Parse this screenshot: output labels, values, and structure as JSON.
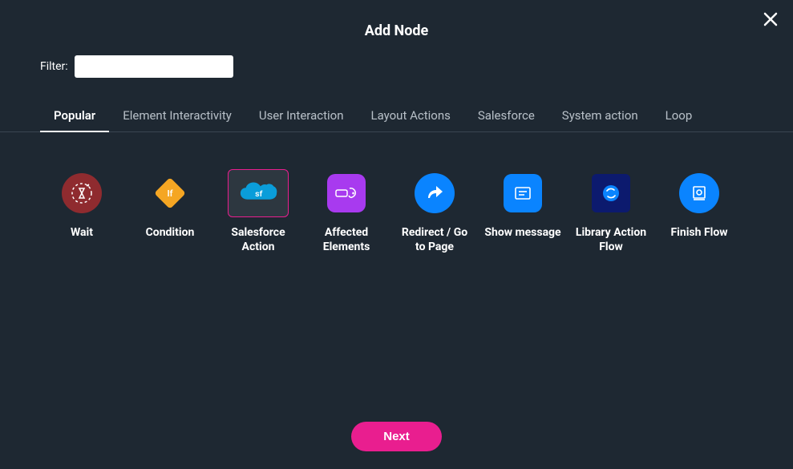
{
  "header": {
    "title": "Add Node"
  },
  "filter": {
    "label": "Filter:",
    "value": ""
  },
  "tabs": [
    {
      "label": "Popular",
      "active": true
    },
    {
      "label": "Element Interactivity",
      "active": false
    },
    {
      "label": "User Interaction",
      "active": false
    },
    {
      "label": "Layout Actions",
      "active": false
    },
    {
      "label": "Salesforce",
      "active": false
    },
    {
      "label": "System action",
      "active": false
    },
    {
      "label": "Loop",
      "active": false
    }
  ],
  "nodes": [
    {
      "label": "Wait",
      "icon": "wait",
      "selected": false
    },
    {
      "label": "Condition",
      "icon": "condition",
      "selected": false
    },
    {
      "label": "Salesforce Action",
      "icon": "salesforce",
      "selected": true
    },
    {
      "label": "Affected Elements",
      "icon": "affected",
      "selected": false
    },
    {
      "label": "Redirect / Go to Page",
      "icon": "redirect",
      "selected": false
    },
    {
      "label": "Show message",
      "icon": "show-message",
      "selected": false
    },
    {
      "label": "Library Action Flow",
      "icon": "library",
      "selected": false
    },
    {
      "label": "Finish Flow",
      "icon": "finish",
      "selected": false
    }
  ],
  "footer": {
    "next_label": "Next"
  }
}
